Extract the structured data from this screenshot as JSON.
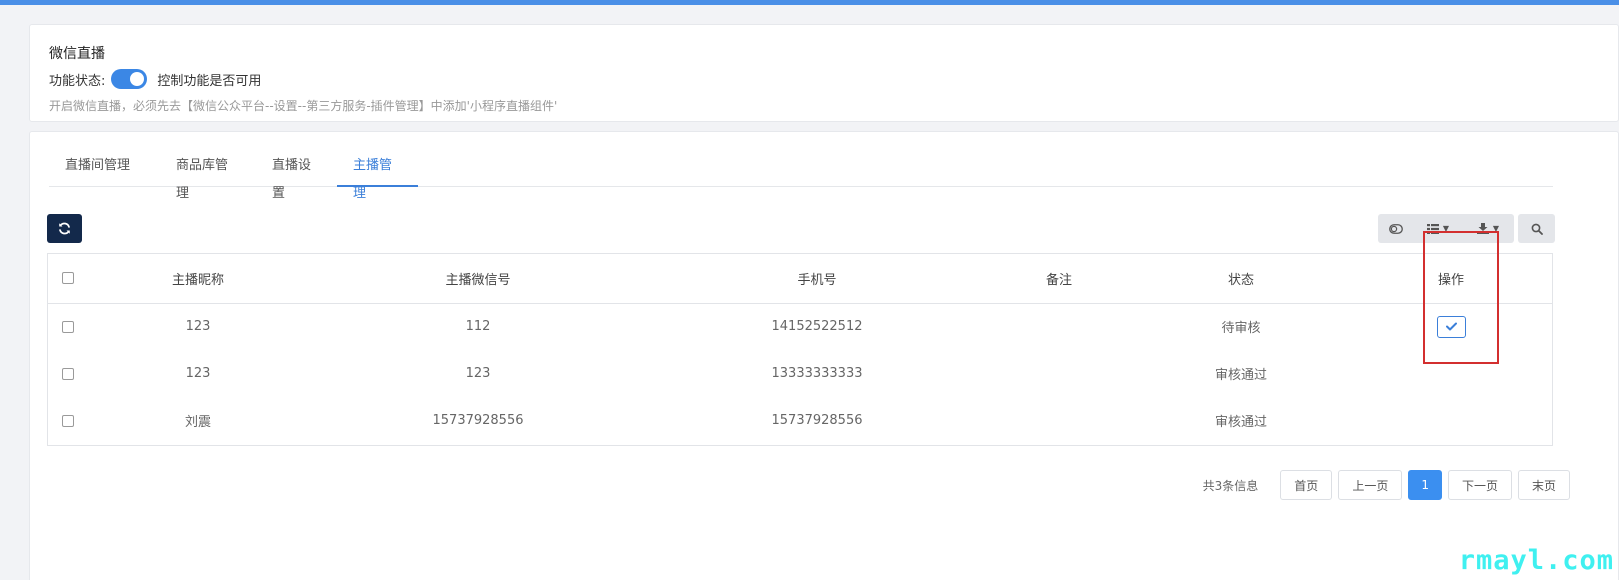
{
  "header": {
    "title": "微信直播",
    "status_label": "功能状态:",
    "status_desc": "控制功能是否可用",
    "hint": "开启微信直播，必须先去【微信公众平台--设置--第三方服务-插件管理】中添加'小程序直播组件'"
  },
  "tabs": [
    {
      "label": "直播间管理"
    },
    {
      "label": "商品库管理"
    },
    {
      "label": "直播设置"
    },
    {
      "label": "主播管理"
    }
  ],
  "active_tab": "主播管理",
  "icons": {
    "refresh": "refresh-icon",
    "toggle_columns": "toggle-icon",
    "columns": "list-icon",
    "export": "download-icon",
    "search": "search-icon",
    "approve": "check-icon"
  },
  "table": {
    "columns": [
      "主播昵称",
      "主播微信号",
      "手机号",
      "备注",
      "状态",
      "操作"
    ],
    "rows": [
      {
        "nickname": "123",
        "wechat": "112",
        "phone": "14152522512",
        "note": "",
        "status": "待审核"
      },
      {
        "nickname": "123",
        "wechat": "123",
        "phone": "13333333333",
        "note": "",
        "status": "审核通过"
      },
      {
        "nickname": "刘震",
        "wechat": "15737928556",
        "phone": "15737928556",
        "note": "",
        "status": "审核通过"
      }
    ]
  },
  "pagination": {
    "info": "共3条信息",
    "first": "首页",
    "prev": "上一页",
    "current": "1",
    "next": "下一页",
    "last": "末页"
  },
  "watermark": "rmayl.com",
  "colors": {
    "accent": "#3b7fd9",
    "toggle_on": "#3b87e5",
    "highlight": "#d32f2f",
    "dark_button": "#13294b"
  }
}
